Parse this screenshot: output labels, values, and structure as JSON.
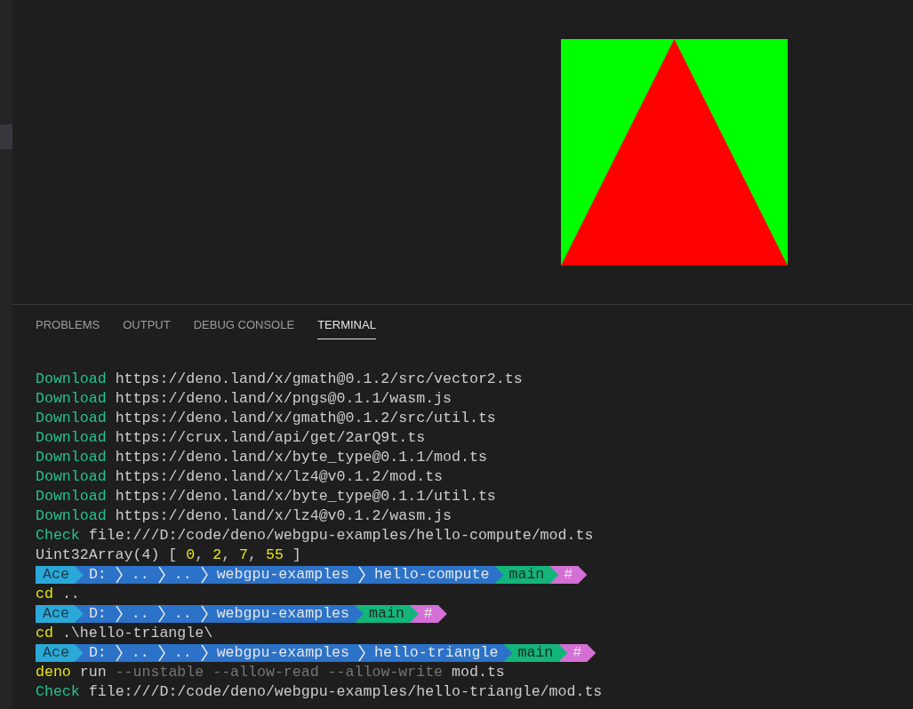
{
  "panel_tabs": [
    {
      "label": "PROBLEMS",
      "selected": false
    },
    {
      "label": "OUTPUT",
      "selected": false
    },
    {
      "label": "DEBUG CONSOLE",
      "selected": false
    },
    {
      "label": "TERMINAL",
      "selected": true
    }
  ],
  "terminal_lines": [
    {
      "kind": "output",
      "segments": [
        {
          "text": "Download",
          "kind": "success"
        },
        {
          "text": " https://deno.land/x/gmath@0.1.2/src/vector2.ts",
          "kind": "plain"
        }
      ]
    },
    {
      "kind": "output",
      "segments": [
        {
          "text": "Download",
          "kind": "success"
        },
        {
          "text": " https://deno.land/x/pngs@0.1.1/wasm.js",
          "kind": "plain"
        }
      ]
    },
    {
      "kind": "output",
      "segments": [
        {
          "text": "Download",
          "kind": "success"
        },
        {
          "text": " https://deno.land/x/gmath@0.1.2/src/util.ts",
          "kind": "plain"
        }
      ]
    },
    {
      "kind": "output",
      "segments": [
        {
          "text": "Download",
          "kind": "success"
        },
        {
          "text": " https://crux.land/api/get/2arQ9t.ts",
          "kind": "plain"
        }
      ]
    },
    {
      "kind": "output",
      "segments": [
        {
          "text": "Download",
          "kind": "success"
        },
        {
          "text": " https://deno.land/x/byte_type@0.1.1/mod.ts",
          "kind": "plain"
        }
      ]
    },
    {
      "kind": "output",
      "segments": [
        {
          "text": "Download",
          "kind": "success"
        },
        {
          "text": " https://deno.land/x/lz4@v0.1.2/mod.ts",
          "kind": "plain"
        }
      ]
    },
    {
      "kind": "output",
      "segments": [
        {
          "text": "Download",
          "kind": "success"
        },
        {
          "text": " https://deno.land/x/byte_type@0.1.1/util.ts",
          "kind": "plain"
        }
      ]
    },
    {
      "kind": "output",
      "segments": [
        {
          "text": "Download",
          "kind": "success"
        },
        {
          "text": " https://deno.land/x/lz4@v0.1.2/wasm.js",
          "kind": "plain"
        }
      ]
    },
    {
      "kind": "output",
      "segments": [
        {
          "text": "Check",
          "kind": "success"
        },
        {
          "text": " file:///D:/code/deno/webgpu-examples/hello-compute/mod.ts",
          "kind": "plain"
        }
      ]
    },
    {
      "kind": "output",
      "segments": [
        {
          "text": "Uint32Array(4) [ ",
          "kind": "plain"
        },
        {
          "text": "0",
          "kind": "number"
        },
        {
          "text": ", ",
          "kind": "plain"
        },
        {
          "text": "2",
          "kind": "number"
        },
        {
          "text": ", ",
          "kind": "plain"
        },
        {
          "text": "7",
          "kind": "number"
        },
        {
          "text": ", ",
          "kind": "plain"
        },
        {
          "text": "55",
          "kind": "number"
        },
        {
          "text": " ]",
          "kind": "plain"
        }
      ]
    },
    {
      "kind": "prompt",
      "segments": [
        {
          "text": "Ace",
          "kind": "user"
        },
        {
          "text": "D:",
          "kind": "path"
        },
        {
          "text": "..",
          "kind": "path"
        },
        {
          "text": "..",
          "kind": "path"
        },
        {
          "text": "webgpu-examples",
          "kind": "path"
        },
        {
          "text": "hello-compute",
          "kind": "path"
        },
        {
          "text": "main",
          "kind": "branch"
        },
        {
          "text": "#",
          "kind": "status"
        }
      ]
    },
    {
      "kind": "output",
      "segments": [
        {
          "text": "cd",
          "kind": "command"
        },
        {
          "text": " ..",
          "kind": "plain"
        }
      ]
    },
    {
      "kind": "prompt",
      "segments": [
        {
          "text": "Ace",
          "kind": "user"
        },
        {
          "text": "D:",
          "kind": "path"
        },
        {
          "text": "..",
          "kind": "path"
        },
        {
          "text": "..",
          "kind": "path"
        },
        {
          "text": "webgpu-examples",
          "kind": "path"
        },
        {
          "text": "main",
          "kind": "branch"
        },
        {
          "text": "#",
          "kind": "status"
        }
      ]
    },
    {
      "kind": "output",
      "segments": [
        {
          "text": "cd",
          "kind": "command"
        },
        {
          "text": " .\\hello-triangle\\",
          "kind": "plain"
        }
      ]
    },
    {
      "kind": "prompt",
      "segments": [
        {
          "text": "Ace",
          "kind": "user"
        },
        {
          "text": "D:",
          "kind": "path"
        },
        {
          "text": "..",
          "kind": "path"
        },
        {
          "text": "..",
          "kind": "path"
        },
        {
          "text": "webgpu-examples",
          "kind": "path"
        },
        {
          "text": "hello-triangle",
          "kind": "path"
        },
        {
          "text": "main",
          "kind": "branch"
        },
        {
          "text": "#",
          "kind": "status"
        }
      ]
    },
    {
      "kind": "output",
      "segments": [
        {
          "text": "deno",
          "kind": "command"
        },
        {
          "text": " run ",
          "kind": "plain"
        },
        {
          "text": "--unstable --allow-read --allow-write",
          "kind": "dim"
        },
        {
          "text": " mod.ts",
          "kind": "plain"
        }
      ]
    },
    {
      "kind": "output",
      "segments": [
        {
          "text": "Check",
          "kind": "success"
        },
        {
          "text": " file:///D:/code/deno/webgpu-examples/hello-triangle/mod.ts",
          "kind": "plain"
        }
      ]
    }
  ]
}
